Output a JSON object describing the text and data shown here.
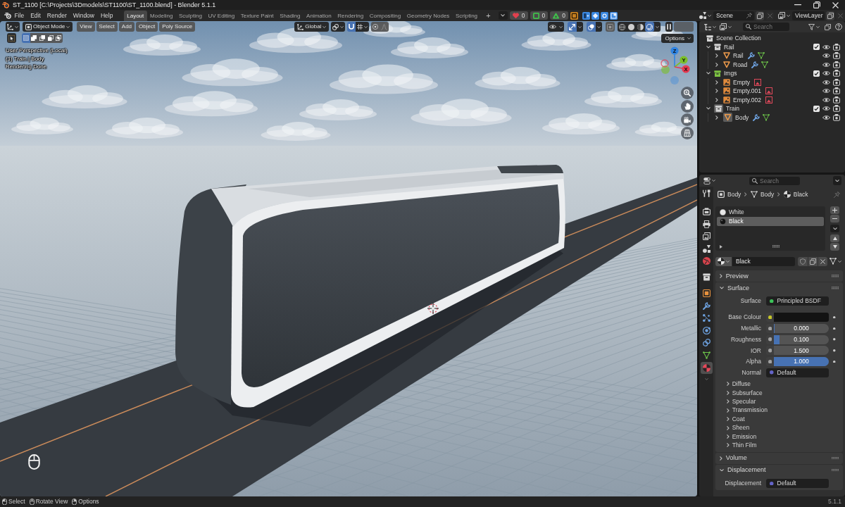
{
  "window": {
    "title": "ST_1100 [C:\\Projects\\3Dmodels\\ST1100\\ST_1100.blend] - Blender 5.1.1"
  },
  "menu": [
    "File",
    "Edit",
    "Render",
    "Window",
    "Help"
  ],
  "workspaces": [
    {
      "label": "Layout",
      "selected": true
    },
    {
      "label": "Modeling",
      "selected": false
    },
    {
      "label": "Sculpting",
      "selected": false
    },
    {
      "label": "UV Editing",
      "selected": false
    },
    {
      "label": "Texture Paint",
      "selected": false
    },
    {
      "label": "Shading",
      "selected": false
    },
    {
      "label": "Animation",
      "selected": false
    },
    {
      "label": "Rendering",
      "selected": false
    },
    {
      "label": "Compositing",
      "selected": false
    },
    {
      "label": "Geometry Nodes",
      "selected": false
    },
    {
      "label": "Scripting",
      "selected": false
    }
  ],
  "workspace_add": "+",
  "counters": [
    {
      "kind": "heart",
      "count": "0",
      "color": "#e0404e"
    },
    {
      "kind": "square",
      "count": "0",
      "color": "#3fbf4a"
    },
    {
      "kind": "triangle",
      "count": "0",
      "color": "#3fbf4a"
    }
  ],
  "scene": {
    "name": "Scene",
    "view_layer": "ViewLayer"
  },
  "viewport": {
    "mode": "Object Mode",
    "menus": [
      "View",
      "Select",
      "Add",
      "Object",
      "Poly Source"
    ],
    "orientation": "Global",
    "snapping": true,
    "proportional": false,
    "gizmos": true,
    "overlays": true,
    "xray": false,
    "shading": [
      {
        "kind": "wireframe",
        "selected": false
      },
      {
        "kind": "solid",
        "selected": false
      },
      {
        "kind": "material",
        "selected": false
      },
      {
        "kind": "rendered",
        "selected": true
      }
    ],
    "options": "Options",
    "select_modes": [
      {
        "kind": "set",
        "selected": true
      },
      {
        "kind": "extend",
        "selected": false
      },
      {
        "kind": "subtract",
        "selected": false
      },
      {
        "kind": "invert",
        "selected": false
      },
      {
        "kind": "intersect",
        "selected": false
      }
    ],
    "info": [
      "User Perspective (Local)",
      "(1) Train | Body",
      "Rendering Done"
    ],
    "axes": [
      {
        "label": "Z",
        "color": "#2f84e3"
      },
      {
        "label": "Y",
        "color": "#7bbf2a"
      },
      {
        "label": "X",
        "color": "#e63950"
      }
    ]
  },
  "outliner": {
    "search_placeholder": "Search",
    "tree": {
      "name": "Scene Collection",
      "kind": "scene_collection",
      "children": [
        {
          "name": "Rail",
          "kind": "collection",
          "color": "#d2d2d2",
          "expanded": true,
          "checked": true,
          "active": false,
          "children": [
            {
              "name": "Rail",
              "kind": "mesh",
              "expanded": false,
              "active": false
            },
            {
              "name": "Road",
              "kind": "mesh",
              "expanded": false,
              "active": false
            }
          ]
        },
        {
          "name": "Imgs",
          "kind": "collection",
          "color": "#7cc242",
          "expanded": true,
          "checked": true,
          "active": false,
          "children": [
            {
              "name": "Empty",
              "kind": "image_empty",
              "expanded": false,
              "active": false
            },
            {
              "name": "Empty.001",
              "kind": "image_empty",
              "expanded": false,
              "active": false
            },
            {
              "name": "Empty.002",
              "kind": "image_empty",
              "expanded": false,
              "active": false
            }
          ]
        },
        {
          "name": "Train",
          "kind": "collection",
          "color": "#d2d2d2",
          "expanded": true,
          "checked": true,
          "active": true,
          "children": [
            {
              "name": "Body",
              "kind": "mesh",
              "expanded": false,
              "active": true
            }
          ]
        }
      ]
    }
  },
  "properties": {
    "search_placeholder": "Search",
    "tabs": [
      {
        "kind": "tool",
        "selected": false
      },
      {
        "kind": "render",
        "selected": false
      },
      {
        "kind": "output",
        "selected": false
      },
      {
        "kind": "view_layer",
        "selected": false
      },
      {
        "kind": "scene",
        "selected": false
      },
      {
        "kind": "world",
        "selected": false
      },
      {
        "kind": "collection",
        "selected": false
      },
      {
        "kind": "object",
        "selected": false
      },
      {
        "kind": "modifiers",
        "selected": false
      },
      {
        "kind": "particles",
        "selected": false
      },
      {
        "kind": "physics",
        "selected": false
      },
      {
        "kind": "constraints",
        "selected": false
      },
      {
        "kind": "data",
        "selected": false
      },
      {
        "kind": "material",
        "selected": true
      }
    ],
    "breadcrumb": [
      {
        "kind": "object",
        "label": "Body"
      },
      {
        "kind": "mesh",
        "label": "Body"
      },
      {
        "kind": "material",
        "label": "Black"
      }
    ],
    "slots": [
      {
        "name": "White",
        "color": "#e6e6e6",
        "selected": false
      },
      {
        "name": "Black",
        "color": "#141414",
        "selected": true
      }
    ],
    "material": "Black",
    "panels": [
      {
        "title": "Preview",
        "expanded": false
      },
      {
        "title": "Surface",
        "expanded": true,
        "rows": [
          {
            "label": "Surface",
            "kind": "link",
            "value": "Principled BSDF",
            "color": "#3cc35a"
          },
          {
            "label": "Base Colour",
            "kind": "swatch",
            "color": "#c7c72a",
            "swatch": {
              "color": "#131313"
            }
          },
          {
            "label": "Metallic",
            "kind": "slider",
            "value": "0.000",
            "level": 0,
            "color": "#a1a1a1"
          },
          {
            "label": "Roughness",
            "kind": "slider",
            "value": "0.100",
            "level": 0.1,
            "color": "#a1a1a1"
          },
          {
            "label": "IOR",
            "kind": "number",
            "value": "1.500",
            "color": "#a1a1a1"
          },
          {
            "label": "Alpha",
            "kind": "slider",
            "value": "1.000",
            "level": 1,
            "color": "#a1a1a1"
          },
          {
            "label": "Normal",
            "kind": "link",
            "value": "Default",
            "color": "#6464c8"
          }
        ],
        "subpanels": [
          {
            "title": "Diffuse",
            "expanded": false
          },
          {
            "title": "Subsurface",
            "expanded": false
          },
          {
            "title": "Specular",
            "expanded": false
          },
          {
            "title": "Transmission",
            "expanded": false
          },
          {
            "title": "Coat",
            "expanded": false
          },
          {
            "title": "Sheen",
            "expanded": false
          },
          {
            "title": "Emission",
            "expanded": false
          },
          {
            "title": "Thin Film",
            "expanded": false
          }
        ]
      },
      {
        "title": "Volume",
        "expanded": false
      },
      {
        "title": "Displacement",
        "expanded": true,
        "rows": [
          {
            "label": "Displacement",
            "kind": "link",
            "value": "Default",
            "color": "#6464c8"
          }
        ]
      }
    ]
  },
  "status_bar": {
    "hints": [
      {
        "kind": "left",
        "label": "Select"
      },
      {
        "kind": "middle",
        "label": "Rotate View"
      },
      {
        "kind": "right",
        "label": "Options"
      }
    ],
    "version": "5.1.1"
  }
}
